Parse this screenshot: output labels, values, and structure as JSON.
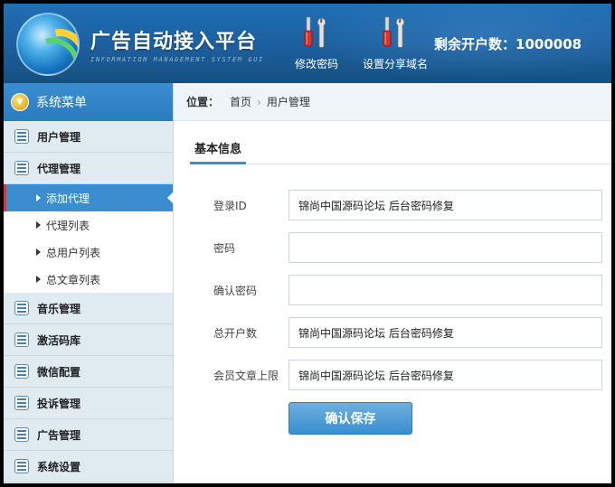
{
  "header": {
    "brand_title": "广告自动接入平台",
    "brand_subtitle": "INFORMATION MANAGEMENT SYSTEM GUI",
    "tools": [
      {
        "label": "修改密码",
        "icon": "tools-icon"
      },
      {
        "label": "设置分享域名",
        "icon": "tools-icon"
      }
    ],
    "remaining_label": "剩余开户数：",
    "remaining_value": "1000008"
  },
  "sidebar": {
    "menu_title": "系统菜单",
    "groups": [
      {
        "label": "用户管理"
      },
      {
        "label": "代理管理",
        "children": [
          {
            "label": "添加代理",
            "active": true
          },
          {
            "label": "代理列表"
          },
          {
            "label": "总用户列表"
          },
          {
            "label": "总文章列表"
          }
        ]
      },
      {
        "label": "音乐管理"
      },
      {
        "label": "激活码库"
      },
      {
        "label": "微信配置"
      },
      {
        "label": "投诉管理"
      },
      {
        "label": "广告管理"
      },
      {
        "label": "系统设置"
      }
    ]
  },
  "breadcrumb": {
    "label": "位置：",
    "items": [
      "首页",
      "用户管理"
    ],
    "separator": "›"
  },
  "tabs": [
    {
      "label": "基本信息"
    }
  ],
  "form": {
    "fields": [
      {
        "label": "登录ID",
        "value": "锦尚中国源码论坛 后台密码修复"
      },
      {
        "label": "密码",
        "value": ""
      },
      {
        "label": "确认密码",
        "value": ""
      },
      {
        "label": "总开户数",
        "value": "锦尚中国源码论坛 后台密码修复"
      },
      {
        "label": "会员文章上限",
        "value": "锦尚中国源码论坛 后台密码修复"
      }
    ],
    "submit_label": "确认保存"
  },
  "colors": {
    "header_blue": "#1d5f9e",
    "accent_blue": "#3a8ed0",
    "active_marker": "#e0312a",
    "sidebar_bg": "#e8f1f6"
  }
}
